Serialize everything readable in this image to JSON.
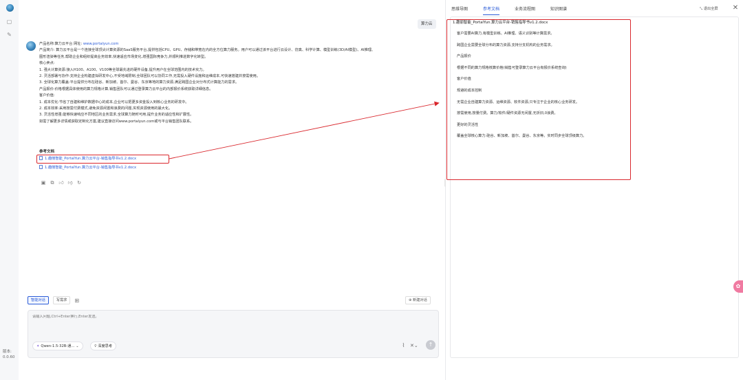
{
  "rail": {
    "version_label": "版本:",
    "version_value": "0.0.60"
  },
  "chat": {
    "user_message": "算力云",
    "answer_lines": [
      {
        "text": "产品名称:算力云平台 网址: ",
        "link": "www.portalyun.com"
      },
      {
        "text": "产品简介: 算力云平台是一个连接全球顶尖计算资源的SaaS服务平台,提供包括CPU、GPU、存储和带宽在内的全方位算力服务。用户可以通过该平台进行云设计、仿真、科学计算、模型训练(3D/AI模型)、AI推理、",
        "link": ""
      },
      {
        "text": "图形渲染等任务,帮助企业和组织提高业务效率,快速适应市场变化,增强国际竞争力,并顺利推进数字化转型。",
        "link": ""
      },
      {
        "text": "核心卖点:",
        "link": ""
      },
      {
        "text": "1. 强大计算资源:接入H100、A100、V100等全球最先进的硬件设备,提升用户在全球范围内的技术实力。",
        "link": ""
      },
      {
        "text": "2. 灵活部署与协作:支持企业构建虚拟研发中心,不受地域限制,全球团队可以协同工作,无需投入硬件设施和运维成本,可快速搭建并按需使用。",
        "link": ""
      },
      {
        "text": "3. 全球化算力覆盖:平台提供分布在硅谷、新加坡、首尔、曼谷、东京等地的算力资源,满足跨国企业对分布式计算能力的需求。",
        "link": ""
      },
      {
        "text": "产品报价:价格根据具体使用的算力规格计算,销售团队可以通过登录算力云平台的内部报价系统获取详细信息。",
        "link": ""
      },
      {
        "text": "客户价值:",
        "link": ""
      },
      {
        "text": "1. 成本优化:节省了自建和维护数据中心的成本,企业可以把更多资金投入到核心业务的研发中。",
        "link": ""
      },
      {
        "text": "2. 成本效率:采用按需付费模式,避免资源闲置和浪费的问题,实现资源使用的最大化。",
        "link": ""
      },
      {
        "text": "3. 灵活性增强:能够快速响应不同地区的业务需求,全球算力随时可用,提升业务的适应性和扩展性。",
        "link": ""
      },
      {
        "text": "如需了解更多详情或获取定制化方案,建议直接访问www.portalyun.com或与平台销售团队联系。",
        "link": ""
      }
    ],
    "refs_title": "参考文档",
    "refs": [
      "1.趣丽智能_PortalYun.算力云平台-销售指导书v1.2.docx",
      "1.趣丽智能_PortalYun.算力云平台-销售指导书v1.2.docx"
    ],
    "action_icons": [
      "copy-icon",
      "duplicate-icon",
      "thumbs-up-icon",
      "thumbs-down-icon",
      "refresh-icon"
    ]
  },
  "composer": {
    "mode_smart": "智能对话",
    "mode_write": "写需求",
    "new_chat": "新建对话",
    "placeholder": "请输入问题,Ctrl+Enter换行,Enter发送。",
    "model": "Qwen-1.5-32B-通…",
    "deep_think": "深度思考"
  },
  "panel": {
    "tabs": [
      "思维导图",
      "参考文档",
      "业务流程图",
      "知识图谱"
    ],
    "active_tab": 1,
    "exit_fullscreen": "退出全屏",
    "doc_title": "1.趣丽智能_PortalYun.算力云平台-销售指导书v1.2.docx",
    "doc_paragraphs": [
      "客户需要AI算力,有模型训练、AI推理、语义识别等计算需求。",
      "跨国企业需要全球分布的算力资源,支持分支机构的业务需求。",
      "产品报价",
      "根据不同的算力规格核算价格(销售可登录算力云平台有报价系统查询)",
      "客户价值",
      "规避的成本控制",
      "无需企业自建算力资源、运维资源、软件资源,只专注于企业的核心业务研发。",
      "按需使用,按量付费。算力/软件/硬件资源无闲置,无折旧,0浪费。",
      "更好的灵活性",
      "覆盖全球核心算力:硅谷、新加坡、首尔、曼谷、东京等。实时同步全球顶级算力。"
    ]
  },
  "colors": {
    "accent": "#2a5bd7",
    "annotation_red": "#d9262c",
    "float_pink": "#f07aa1"
  }
}
